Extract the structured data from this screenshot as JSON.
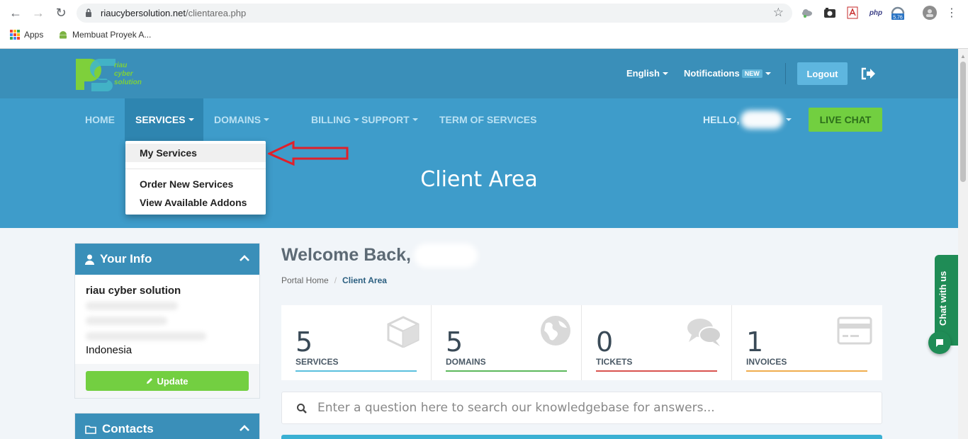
{
  "browser": {
    "url_host": "riaucybersolution.net",
    "url_path": "/clientarea.php",
    "bookmarks": [
      {
        "label": "Apps"
      },
      {
        "label": "Membuat Proyek A..."
      }
    ],
    "extension_badge": "5.76",
    "extension_php": "php"
  },
  "header": {
    "logo_text_line1": "riau",
    "logo_text_line2": "cyber",
    "logo_text_line3": "solution",
    "language": "English",
    "notifications": "Notifications",
    "notifications_badge": "NEW",
    "logout": "Logout"
  },
  "nav": {
    "items": [
      {
        "label": "HOME"
      },
      {
        "label": "SERVICES"
      },
      {
        "label": "DOMAINS"
      },
      {
        "label": "BILLING"
      },
      {
        "label": "SUPPORT"
      },
      {
        "label": "TERM OF SERVICES"
      }
    ],
    "hello": "HELLO, ",
    "live_chat": "LIVE CHAT"
  },
  "services_menu": {
    "items": [
      {
        "label": "My Services"
      },
      {
        "label": "Order New Services"
      },
      {
        "label": "View Available Addons"
      }
    ]
  },
  "hero": {
    "title": "Client Area"
  },
  "sidebar": {
    "your_info": {
      "title": "Your Info",
      "company": "riau cyber solution",
      "country": "Indonesia",
      "update": "Update"
    },
    "contacts": {
      "title": "Contacts"
    }
  },
  "main": {
    "welcome": "Welcome Back,",
    "breadcrumb": {
      "home": "Portal Home",
      "separator": "/",
      "current": "Client Area"
    },
    "tiles": [
      {
        "count": "5",
        "label": "SERVICES",
        "color": "#5bc0de"
      },
      {
        "count": "5",
        "label": "DOMAINS",
        "color": "#5cb85c"
      },
      {
        "count": "0",
        "label": "TICKETS",
        "color": "#d9534f"
      },
      {
        "count": "1",
        "label": "INVOICES",
        "color": "#f0ad4e"
      }
    ],
    "kb_search_placeholder": "Enter a question here to search our knowledgebase for answers..."
  },
  "chat": {
    "tab_label": "Chat with us"
  },
  "colors": {
    "header_bg": "#3a8fb9",
    "nav_bg": "#3e9cca",
    "green": "#72cf40",
    "annotation_arrow": "#e0202a"
  }
}
